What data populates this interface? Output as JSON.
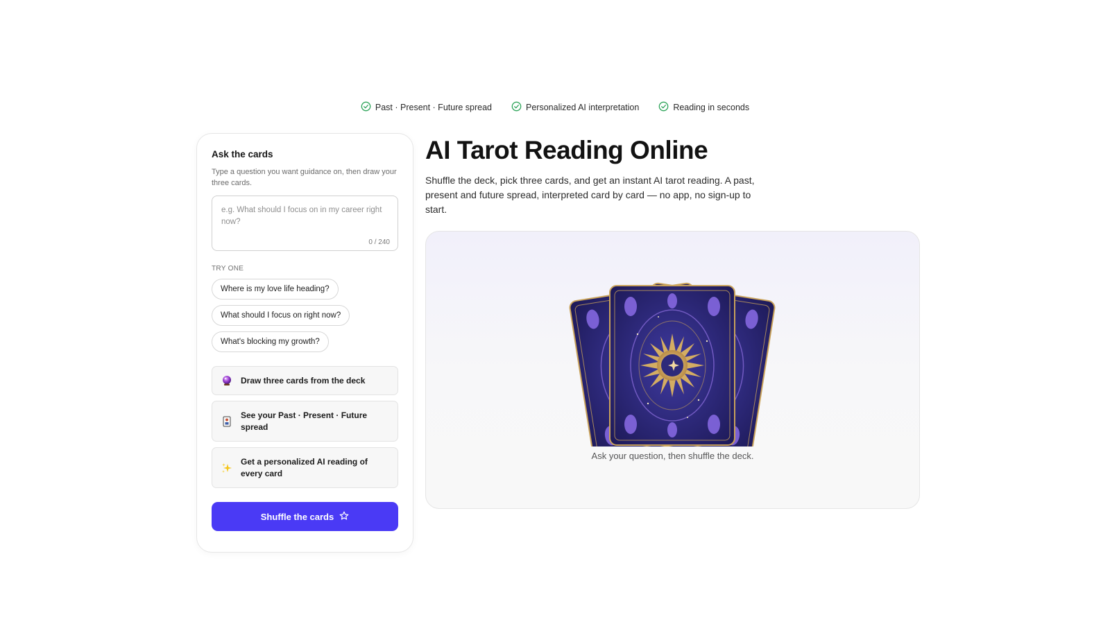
{
  "benefits": [
    {
      "label": "Past · Present · Future spread",
      "icon": "check-circle-icon"
    },
    {
      "label": "Personalized AI interpretation",
      "icon": "check-circle-icon"
    },
    {
      "label": "Reading in seconds",
      "icon": "check-circle-icon"
    }
  ],
  "ask_panel": {
    "title": "Ask the cards",
    "subtitle": "Type a question you want guidance on, then draw your three cards.",
    "question_placeholder": "e.g. What should I focus on in my career right now?",
    "question_value": "",
    "counter": "0 / 240",
    "try_label": "TRY ONE",
    "suggestions": [
      "Where is my love life heading?",
      "What should I focus on right now?",
      "What's blocking my growth?"
    ],
    "steps": [
      {
        "label": "Draw three cards from the deck",
        "icon": "crystal-ball-icon"
      },
      {
        "label": "See your Past · Present · Future spread",
        "icon": "tarot-card-icon"
      },
      {
        "label": "Get a personalized AI reading of every card",
        "icon": "sparkles-icon"
      }
    ],
    "shuffle_button": "Shuffle the cards"
  },
  "main": {
    "title": "AI Tarot Reading Online",
    "intro": "Shuffle the deck, pick three cards, and get an instant AI tarot reading. A past, present and future spread, interpreted card by card — no app, no sign-up to start.",
    "stage_caption": "Ask your question, then shuffle the deck."
  },
  "colors": {
    "accent": "#4a3af5",
    "check": "#2fa45a",
    "card_back": "#2e2a7a",
    "card_gold": "#c9a25a"
  }
}
